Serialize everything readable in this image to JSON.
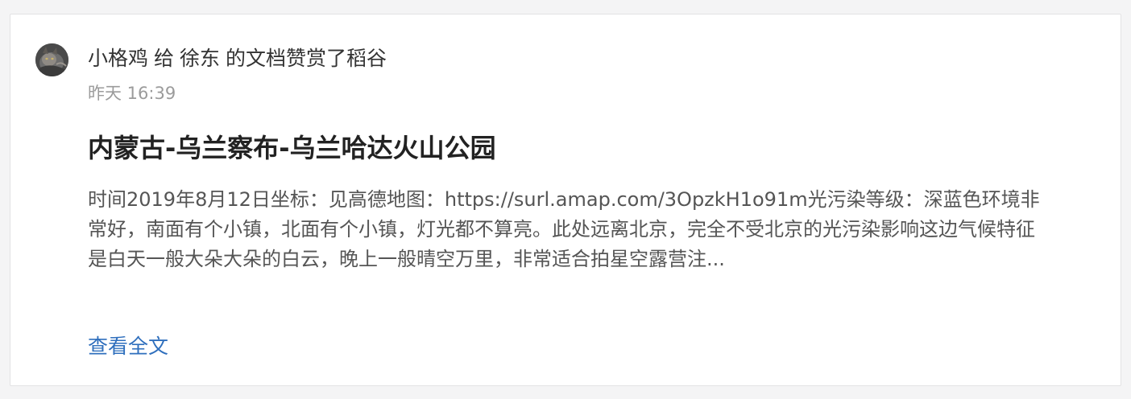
{
  "feed_item": {
    "actor": "小格鸡",
    "verb": "给",
    "target_user": "徐东",
    "action_text": "的文档赞赏了稻谷",
    "timestamp": "昨天 16:39",
    "doc_title": "内蒙古-乌兰察布-乌兰哈达火山公园",
    "excerpt": "时间2019年8月12日坐标：见高德地图：https://surl.amap.com/3OpzkH1o91m光污染等级：深蓝色环境非常好，南面有个小镇，北面有个小镇，灯光都不算亮。此处远离北京，完全不受北京的光污染影响这边气候特征是白天一般大朵大朵的白云，晚上一般晴空万里，非常适合拍星空露营注...",
    "read_more_label": "查看全文",
    "avatar_icon": "cat-photo-avatar"
  },
  "colors": {
    "link": "#2f6fbd",
    "text_primary": "#333333",
    "text_muted": "#9b9b9b",
    "background": "#f4f4f5",
    "card_border": "#e2e2e4"
  }
}
